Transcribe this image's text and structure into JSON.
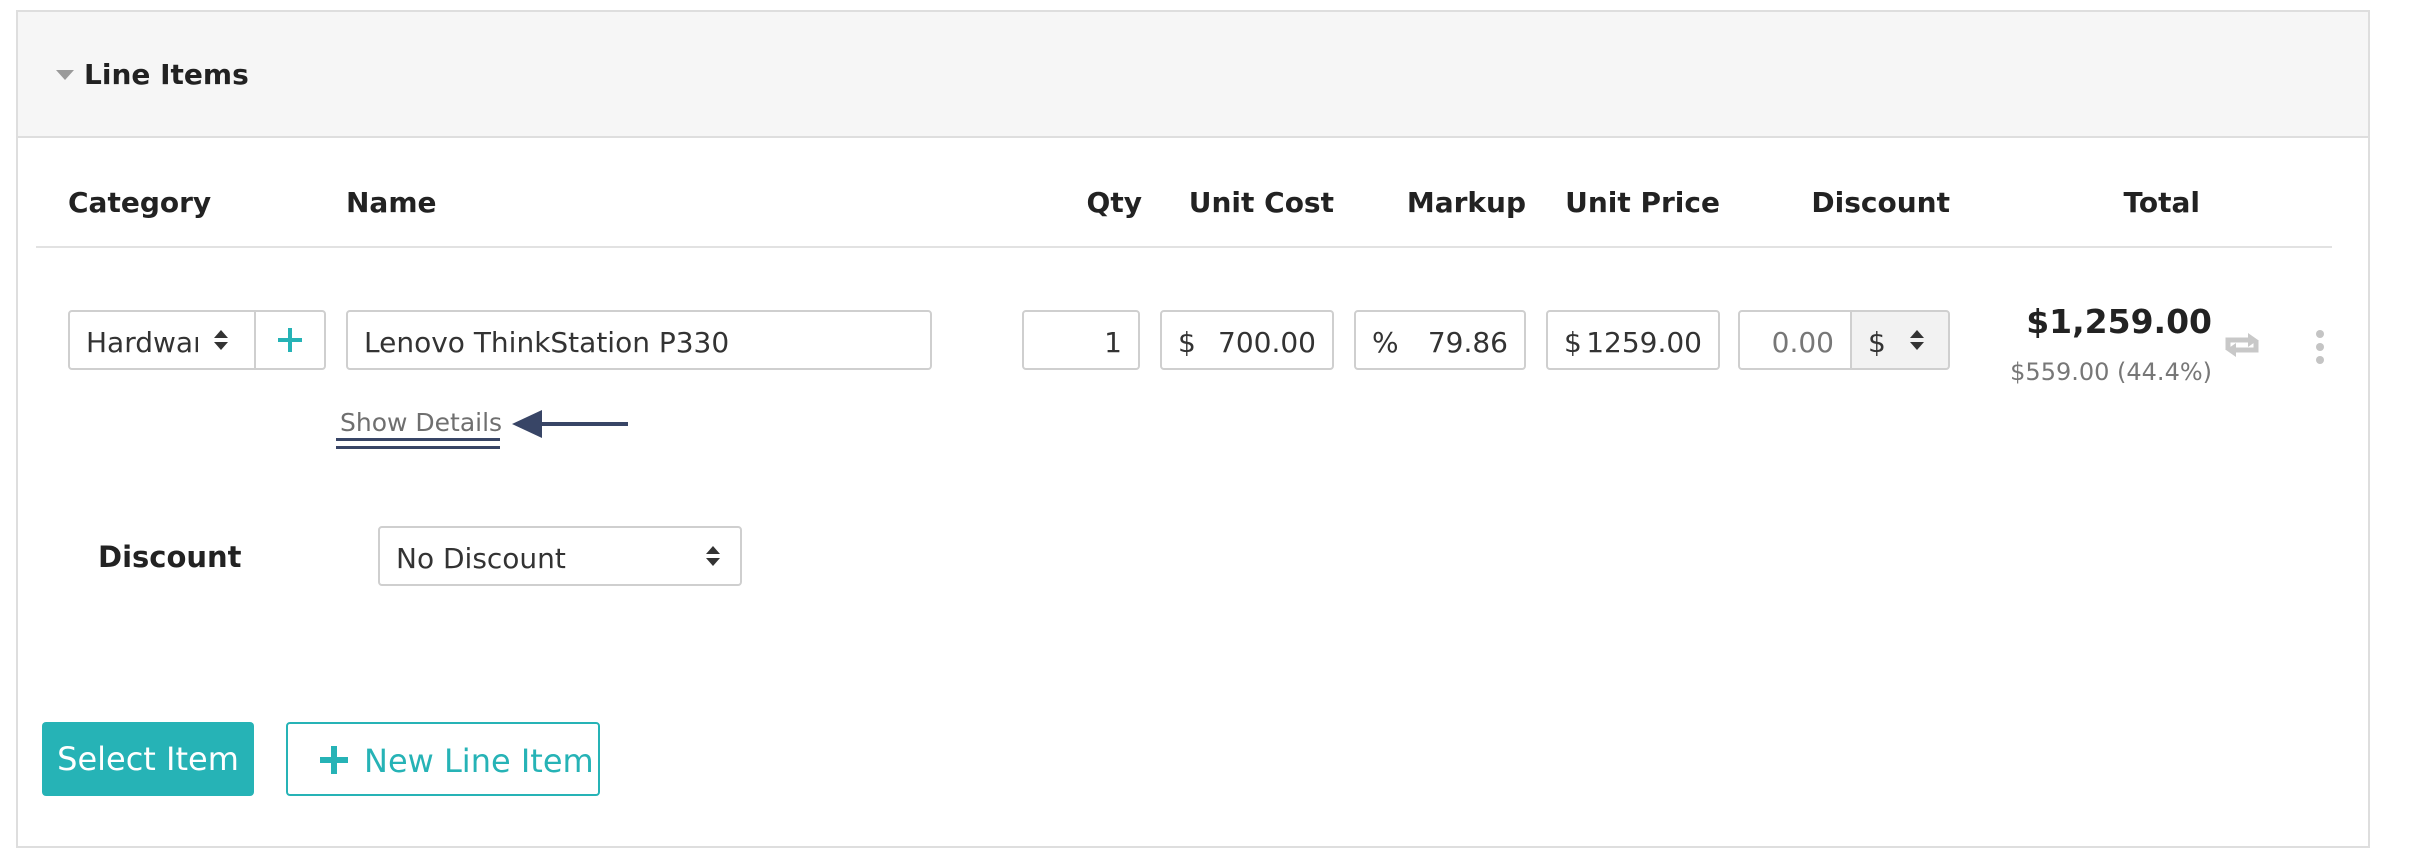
{
  "section": {
    "title": "Line Items"
  },
  "columns": {
    "category": "Category",
    "name": "Name",
    "qty": "Qty",
    "unit_cost": "Unit Cost",
    "markup": "Markup",
    "unit_price": "Unit Price",
    "discount": "Discount",
    "total": "Total"
  },
  "row": {
    "category_value": "Hardware",
    "name_value": "Lenovo ThinkStation P330",
    "qty_value": "1",
    "unit_cost_prefix": "$",
    "unit_cost_value": "700.00",
    "markup_prefix": "%",
    "markup_value": "79.86",
    "unit_price_prefix": "$",
    "unit_price_value": "1259.00",
    "discount_value": "0.00",
    "discount_unit": "$",
    "total": "$1,259.00",
    "profit": "$559.00 (44.4%)",
    "show_details": "Show Details"
  },
  "discount": {
    "label": "Discount",
    "selected": "No Discount"
  },
  "buttons": {
    "select_item": "Select Item",
    "new_line_item": "New Line Item"
  },
  "colors": {
    "accent": "#26b3b6",
    "annotation": "#384566"
  },
  "icons": {
    "collapse": "caret-down-icon",
    "add_category": "plus-icon",
    "repeat": "repeat-icon",
    "more": "more-vertical-icon",
    "new_line_item": "plus-icon"
  }
}
